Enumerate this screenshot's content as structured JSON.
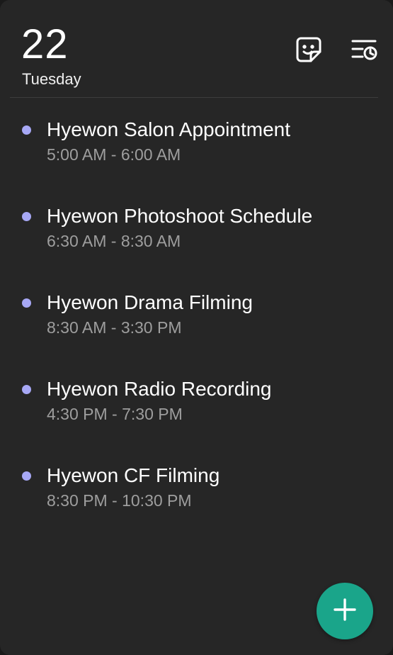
{
  "header": {
    "date_number": "22",
    "weekday": "Tuesday",
    "sticker_icon": "sticker-smile-icon",
    "schedule_icon": "list-clock-icon"
  },
  "events": [
    {
      "title": "Hyewon Salon Appointment",
      "time": "5:00 AM - 6:00 AM"
    },
    {
      "title": "Hyewon Photoshoot Schedule",
      "time": "6:30 AM - 8:30 AM"
    },
    {
      "title": "Hyewon Drama Filming",
      "time": "8:30 AM - 3:30 PM"
    },
    {
      "title": "Hyewon Radio Recording",
      "time": "4:30 PM - 7:30 PM"
    },
    {
      "title": "Hyewon CF Filming",
      "time": "8:30 PM - 10:30 PM"
    }
  ],
  "fab": {
    "icon": "plus-icon"
  },
  "colors": {
    "background": "#262626",
    "event_dot": "#a7a8f5",
    "fab": "#1aa58a",
    "secondary_text": "#9e9e9e"
  }
}
